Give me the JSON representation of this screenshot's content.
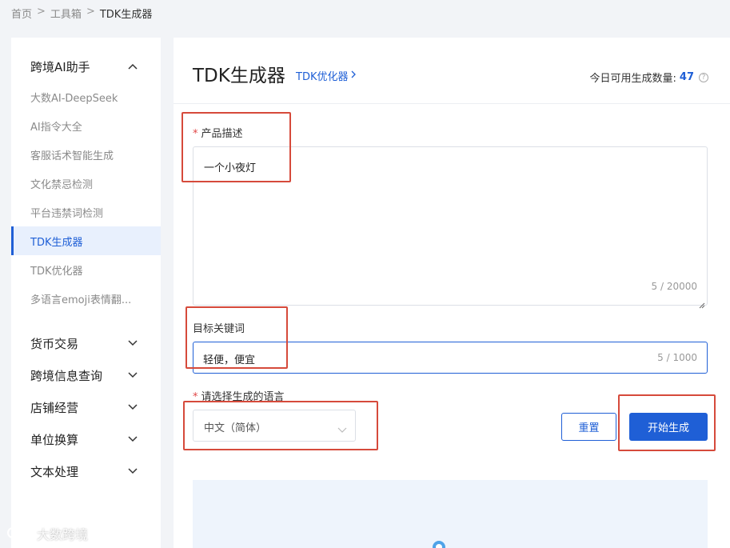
{
  "breadcrumb": {
    "home": "首页",
    "tools": "工具箱",
    "current": "TDK生成器",
    "sep": ">"
  },
  "sidebar": {
    "group_ai": {
      "label": "跨境AI助手",
      "icon": "chevron-up-icon"
    },
    "items": [
      "大数AI-DeepSeek",
      "AI指令大全",
      "客服话术智能生成",
      "文化禁忌检测",
      "平台违禁词检测",
      "TDK生成器",
      "TDK优化器",
      "多语言emoji表情翻..."
    ],
    "active_index": 5,
    "groups": [
      "货币交易",
      "跨境信息查询",
      "店铺经营",
      "单位换算",
      "文本处理"
    ]
  },
  "header": {
    "title": "TDK生成器",
    "optimizer_link": "TDK优化器",
    "quota_label": "今日可用生成数量:",
    "quota_value": "47"
  },
  "form": {
    "desc_label": "产品描述",
    "desc_value": "一个小夜灯",
    "desc_count": "5 / 20000",
    "keyword_label": "目标关键词",
    "keyword_value": "轻便，便宜",
    "keyword_count": "5 / 1000",
    "lang_label": "请选择生成的语言",
    "lang_value": "中文（简体）",
    "required_mark": "*",
    "reset_label": "重置",
    "generate_label": "开始生成"
  },
  "watermark": {
    "text": "大数跨境"
  },
  "colors": {
    "accent": "#1f5fd6",
    "highlight": "#d64a3b",
    "required": "#e04646"
  }
}
